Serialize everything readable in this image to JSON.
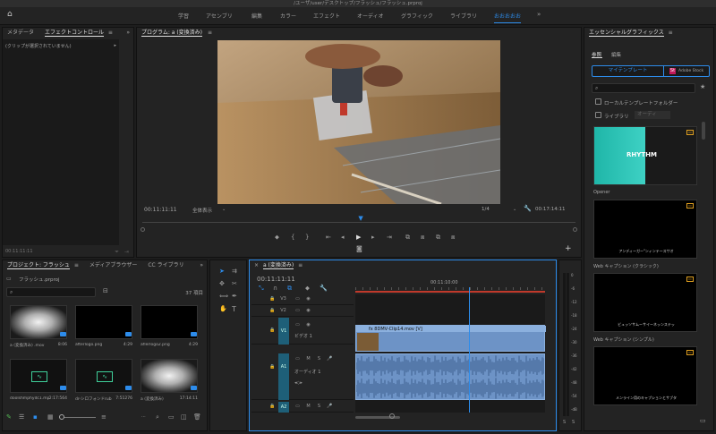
{
  "window_title": "/ユーザ/user/デスクトップ/フラッシュ/フラッシュ.prproj",
  "workspaces": [
    "学習",
    "アセンブリ",
    "編集",
    "カラー",
    "エフェクト",
    "オーディオ",
    "グラフィック",
    "ライブラリ",
    "おおおおお"
  ],
  "effect_panel": {
    "tab_metadata": "メタデータ",
    "tab_effect": "エフェクトコントロール",
    "no_clip": "(クリップが選択されていません)",
    "timecode": "00:11:11:11"
  },
  "program": {
    "title": "プログラム: a (変換済み)",
    "timecode": "00:11:11:11",
    "fit": "全体表示",
    "quality": "1/4",
    "duration": "00:17:14:11",
    "playhead_fraction": 0.505
  },
  "project": {
    "tab_project": "プロジェクト: フラッシュ",
    "tab_media": "メディアブラウザー",
    "tab_libraries": "CC ライブラリ",
    "file": "フラッシュ.prproj",
    "count": "37 項目",
    "items": [
      {
        "name": "a (変換済み) .mov",
        "dur": "8:06",
        "kind": "glow"
      },
      {
        "name": "afterlogo.png",
        "dur": "4:29",
        "kind": "black"
      },
      {
        "name": "aflerlogo2.png",
        "dur": "4:29",
        "kind": "black"
      },
      {
        "name": "doolshmphydc1.mp3",
        "dur": "2:17:564",
        "kind": "audio"
      },
      {
        "name": "dr-シロフォンドrub",
        "dur": "7:51276",
        "kind": "audio"
      },
      {
        "name": "a (変換済み)",
        "dur": "17:14:11",
        "kind": "glow"
      }
    ]
  },
  "timeline": {
    "title": "a (変換済み)",
    "timecode": "00:11:11:11",
    "ruler_label": "00:11:10:00",
    "playhead_fraction": 0.6,
    "tracks": [
      "V3",
      "V2",
      "V1",
      "A1",
      "A2"
    ],
    "track_names": {
      "v1": "ビデオ 1",
      "a1": "オーディオ 1"
    },
    "clip_label": "fx 8DMV-Clip14.mov [V]",
    "meter_db": [
      "0",
      "-6",
      "-12",
      "-18",
      "-24",
      "-30",
      "-36",
      "-42",
      "-48",
      "-54",
      "-dB"
    ]
  },
  "essential": {
    "title": "エッセンシャルグラフィックス",
    "tab_browse": "参照",
    "tab_edit": "編集",
    "my_templates": "マイテンプレート",
    "adobe_stock": "Adobe Stock",
    "local_folder": "ローカルテンプレートフォルダー",
    "libraries": "ライブラリ",
    "library_option": "オーディ",
    "templates": [
      {
        "thumb_text": "RHYTHM",
        "label": "Opener"
      },
      {
        "thumb_text": "アンディーガー\"ンィンテースサオ",
        "label": "Web キャプション (クラシック)"
      },
      {
        "thumb_text": "ビュッソサムーサイーネッンステッ",
        "label": "Web キャプション (シンプル)"
      },
      {
        "thumb_text": "メンライン用のキャプションとサブタ",
        "label": ""
      }
    ]
  },
  "colors": {
    "accent": "#2d8ceb",
    "clip_blue": "#6d93c6",
    "teal": "#1e5f78"
  }
}
